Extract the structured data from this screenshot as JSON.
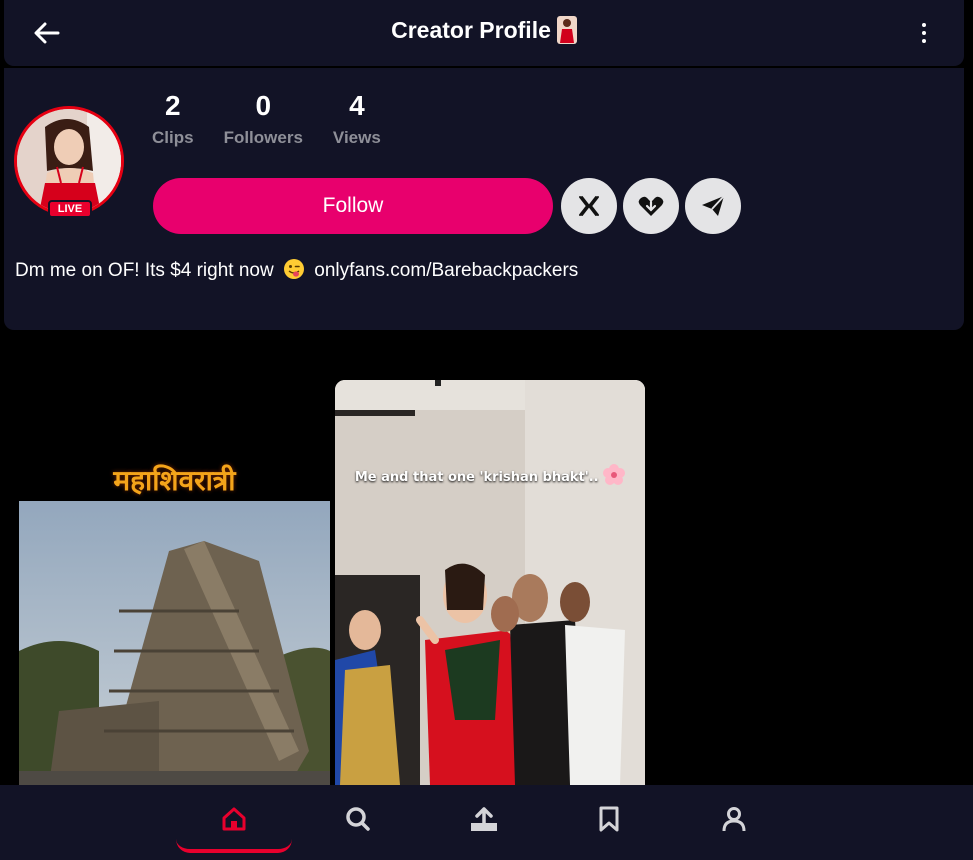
{
  "header": {
    "title": "Creator Profile",
    "back_icon": "arrow-left-icon",
    "more_icon": "more-vertical-icon"
  },
  "profile": {
    "live_label": "LIVE",
    "stats": [
      {
        "value": "2",
        "label": "Clips"
      },
      {
        "value": "0",
        "label": "Followers"
      },
      {
        "value": "4",
        "label": "Views"
      }
    ],
    "follow_label": "Follow",
    "social": [
      "x-icon",
      "link-icon",
      "telegram-icon"
    ],
    "bio_before": "Dm me on OF! Its $4 right now",
    "bio_after": "onlyfans.com/Barebackpackers"
  },
  "clips": [
    {
      "overlay_text": "महाशिवरात्री"
    },
    {
      "caption": "Me and that one 'krishan bhakt'.."
    }
  ],
  "nav": {
    "items": [
      "home-icon",
      "search-icon",
      "upload-icon",
      "bookmark-icon",
      "profile-icon"
    ],
    "active": "home-icon"
  },
  "colors": {
    "accent": "#e8006d",
    "live": "#e8002d",
    "card_bg": "#121326"
  }
}
